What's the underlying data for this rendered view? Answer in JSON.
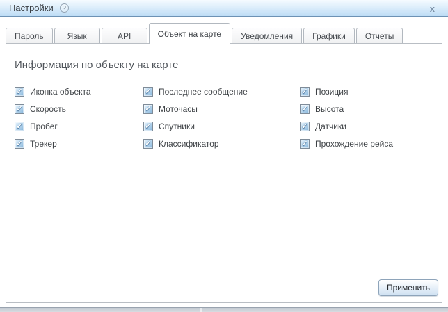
{
  "window": {
    "title": "Настройки",
    "help_icon": "?",
    "close_icon": "x"
  },
  "tabs": [
    {
      "label": "Пароль",
      "active": false
    },
    {
      "label": "Язык",
      "active": false
    },
    {
      "label": "API",
      "active": false
    },
    {
      "label": "Объект на карте",
      "active": true
    },
    {
      "label": "Уведомления",
      "active": false
    },
    {
      "label": "Графики",
      "active": false
    },
    {
      "label": "Отчеты",
      "active": false
    }
  ],
  "panel": {
    "heading": "Информация по объекту на карте",
    "apply_label": "Применить"
  },
  "glyphs": {
    "check": "✓"
  },
  "grid": {
    "columns": [
      {
        "items": [
          {
            "label": "Иконка объекта",
            "checked": true
          },
          {
            "label": "Скорость",
            "checked": true
          },
          {
            "label": "Пробег",
            "checked": true
          },
          {
            "label": "Трекер",
            "checked": true
          }
        ]
      },
      {
        "items": [
          {
            "label": "Последнее сообщение",
            "checked": true
          },
          {
            "label": "Моточасы",
            "checked": true
          },
          {
            "label": "Спутники",
            "checked": true
          },
          {
            "label": "Классификатор",
            "checked": true
          }
        ]
      },
      {
        "items": [
          {
            "label": "Позиция",
            "checked": true
          },
          {
            "label": "Высота",
            "checked": true
          },
          {
            "label": "Датчики",
            "checked": true
          },
          {
            "label": "Прохождение рейса",
            "checked": true
          }
        ]
      }
    ]
  },
  "colors": {
    "titlebar_gradient_top": "#f5fbff",
    "titlebar_gradient_bottom": "#bddcf5",
    "titlebar_border": "#6d92b4",
    "tab_border": "#b2b8bf",
    "panel_border": "#b9bec4",
    "checkbox_blue": "#85b4da",
    "button_gradient_bottom": "#cfe1f2"
  }
}
